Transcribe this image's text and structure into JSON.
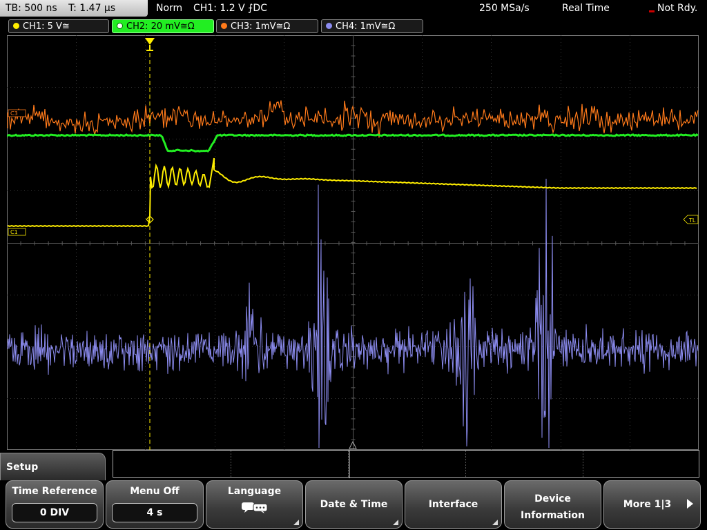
{
  "status_bar": {
    "timebase": "TB: 500 ns",
    "trigger_time": "T: 1.47 µs",
    "acq_mode": "Norm",
    "trigger_info": "CH1: 1.2 V ⨍DC",
    "sample_rate": "250 MSa/s",
    "display_mode": "Real Time",
    "run_state": "Not Rdy."
  },
  "channels": [
    {
      "label": "CH1: 5 V≅",
      "color": "#ffee00"
    },
    {
      "label": "CH2: 20 mV≅Ω",
      "color": "#22ee22"
    },
    {
      "label": "CH3: 1mV≅Ω",
      "color": "#ff7a1a"
    },
    {
      "label": "CH4: 1mV≅Ω",
      "color": "#8c8cf0"
    }
  ],
  "trace_markers": {
    "c3": "C3",
    "c1": "C1",
    "trigger_level": "TL"
  },
  "menu": {
    "title": "Setup",
    "softkeys": {
      "time_reference": {
        "label": "Time Reference",
        "value": "0 DIV"
      },
      "menu_off": {
        "label": "Menu Off",
        "value": "4 s"
      },
      "language": {
        "label": "Language"
      },
      "date_time": {
        "label": "Date & Time"
      },
      "interface": {
        "label": "Interface"
      },
      "device_info": {
        "line1": "Device",
        "line2": "Information"
      },
      "more": {
        "label": "More 1|3"
      }
    }
  }
}
